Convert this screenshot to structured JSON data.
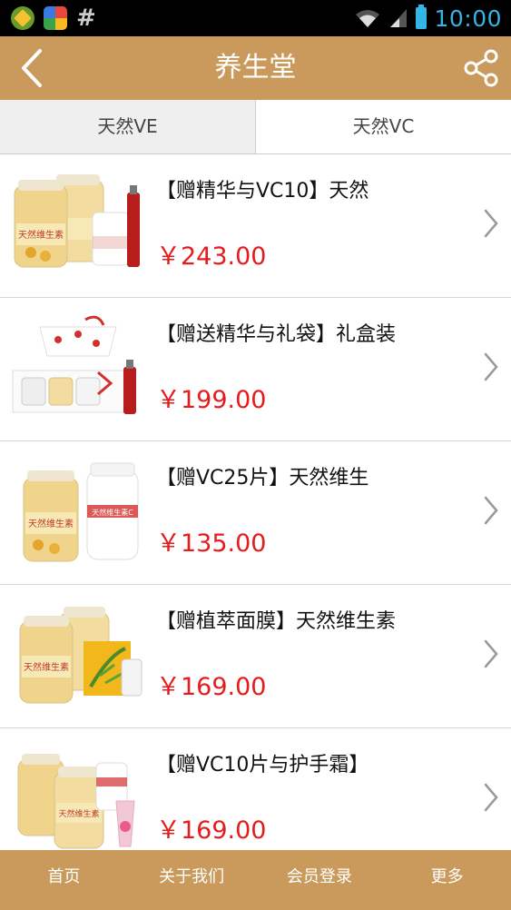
{
  "status_bar": {
    "time": "10:00",
    "notification_icons": [
      "app-icon-green",
      "app-icon-colorful",
      "hash-icon"
    ]
  },
  "nav": {
    "title": "养生堂",
    "back_icon": "back-arrow-icon",
    "share_icon": "share-icon"
  },
  "tabs": [
    {
      "label": "天然VE",
      "active": true
    },
    {
      "label": "天然VC",
      "active": false
    }
  ],
  "products": [
    {
      "title": "【赠精华与VC10】天然",
      "price": "￥243.00"
    },
    {
      "title": "【赠送精华与礼袋】礼盒装",
      "price": "￥199.00"
    },
    {
      "title": "【赠VC25片】天然维生",
      "price": "￥135.00"
    },
    {
      "title": "【赠植萃面膜】天然维生素",
      "price": "￥169.00"
    },
    {
      "title": "【赠VC10片与护手霜】",
      "price": "￥169.00"
    }
  ],
  "bottom_nav": [
    {
      "label": "首页"
    },
    {
      "label": "关于我们"
    },
    {
      "label": "会员登录"
    },
    {
      "label": "更多"
    }
  ],
  "colors": {
    "brand": "#c99a5b",
    "price": "#e51c1c",
    "status_accent": "#33b5e5"
  }
}
